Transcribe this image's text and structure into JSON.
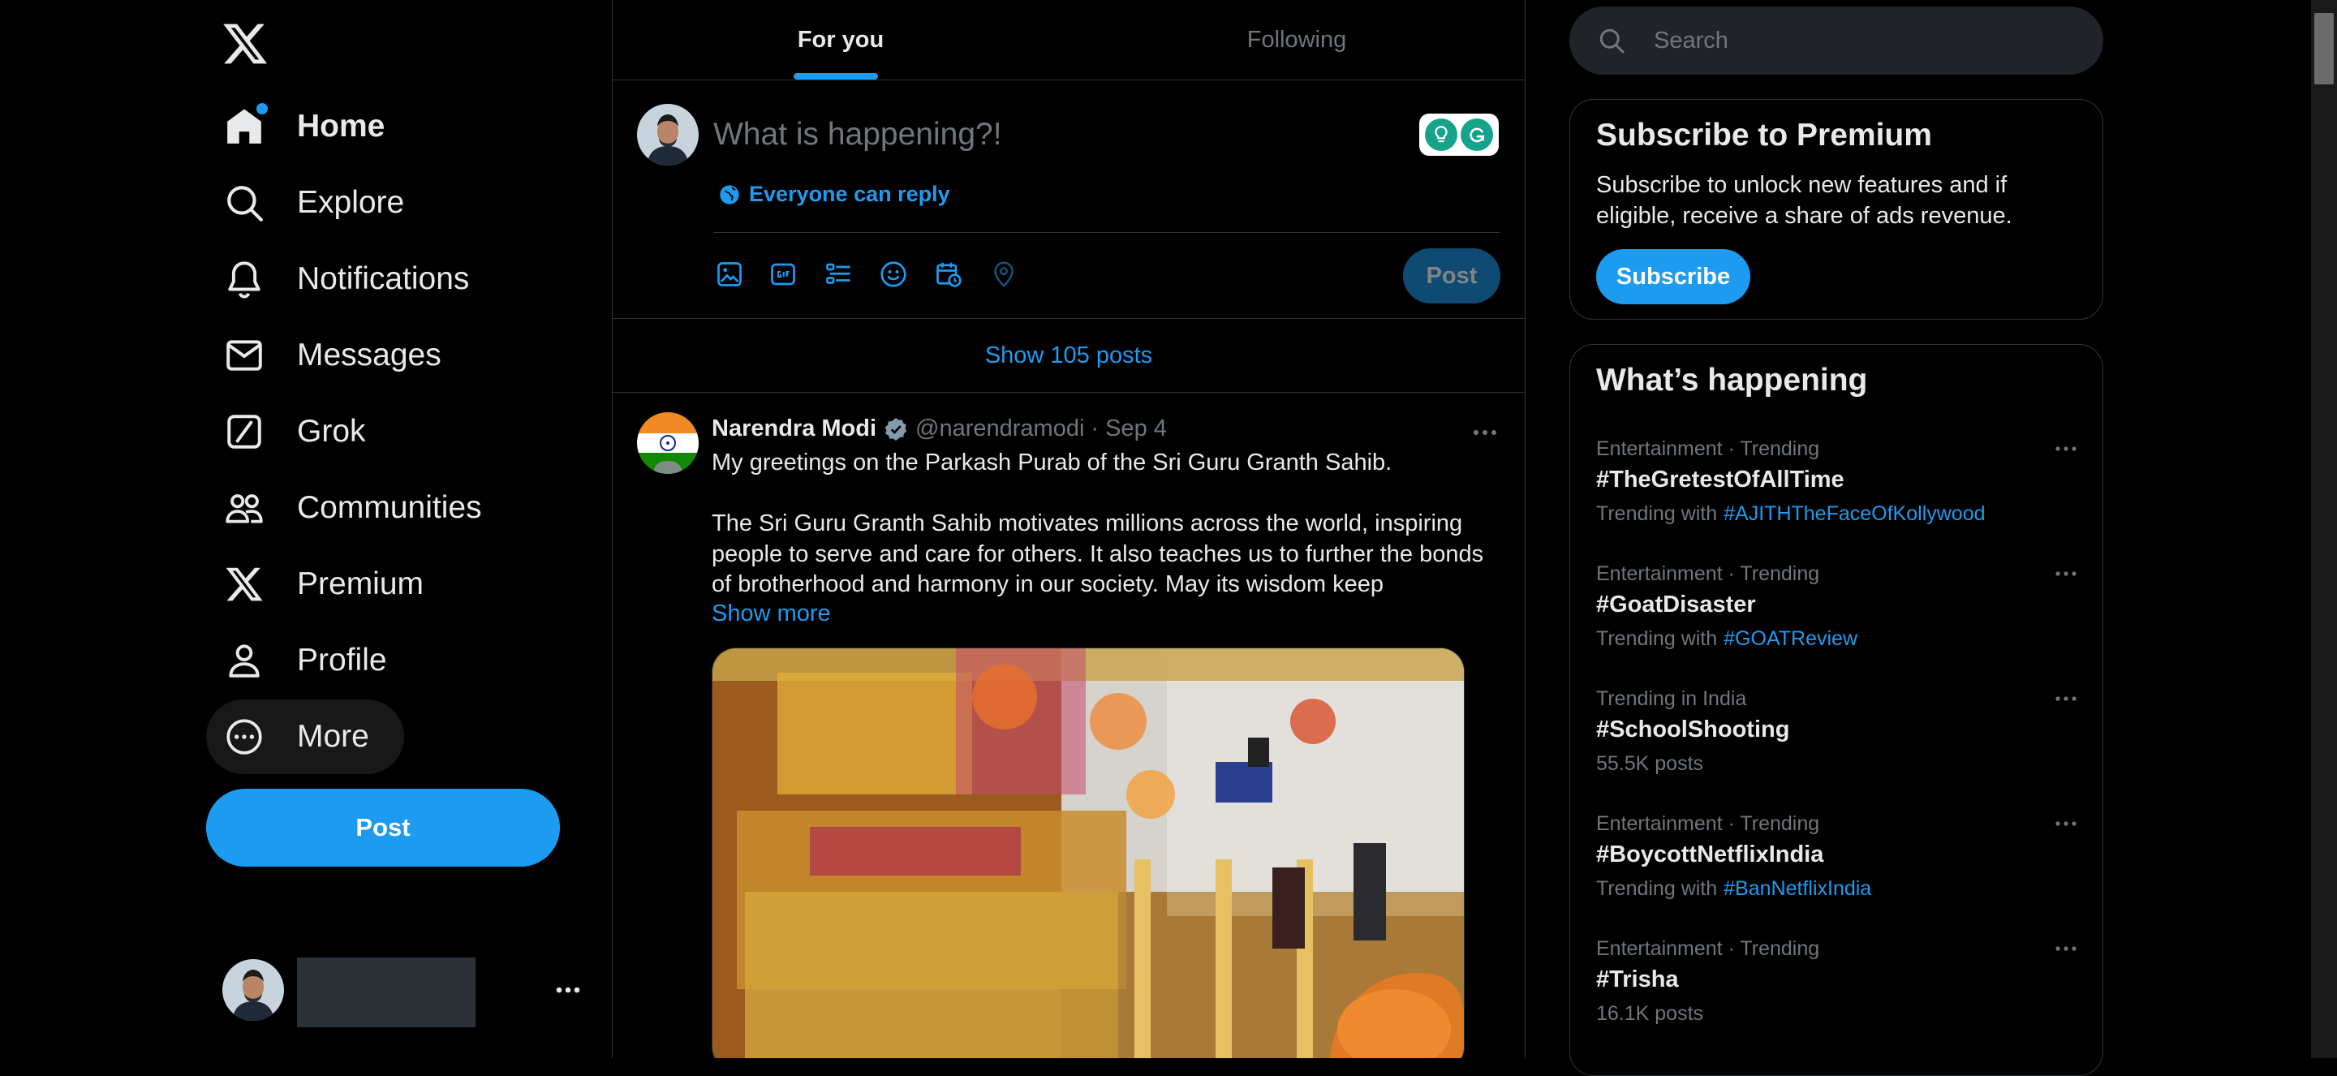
{
  "nav": {
    "items": [
      {
        "label": "Home",
        "icon": "home-icon",
        "active": true
      },
      {
        "label": "Explore",
        "icon": "search-icon"
      },
      {
        "label": "Notifications",
        "icon": "bell-icon"
      },
      {
        "label": "Messages",
        "icon": "envelope-icon"
      },
      {
        "label": "Grok",
        "icon": "grok-icon"
      },
      {
        "label": "Communities",
        "icon": "communities-icon"
      },
      {
        "label": "Premium",
        "icon": "x-logo-icon"
      },
      {
        "label": "Profile",
        "icon": "person-icon"
      },
      {
        "label": "More",
        "icon": "more-circle-icon"
      }
    ],
    "post_label": "Post"
  },
  "feed": {
    "tabs": [
      {
        "label": "For you",
        "active": true
      },
      {
        "label": "Following"
      }
    ],
    "compose": {
      "placeholder": "What is happening?!",
      "reply_setting": "Everyone can reply",
      "post_label": "Post"
    },
    "show_posts": "Show 105 posts",
    "tweet": {
      "author": "Narendra Modi",
      "handle": "@narendramodi",
      "separator": "·",
      "date": "Sep 4",
      "lines": [
        "My greetings on the Parkash Purab of the Sri Guru Granth Sahib.",
        "",
        "The Sri Guru Granth Sahib motivates millions across the world, inspiring people to serve and care for others. It also teaches us to further the bonds of brotherhood and harmony in our society. May its wisdom keep"
      ],
      "show_more": "Show more"
    }
  },
  "sidebar": {
    "search_placeholder": "Search",
    "premium": {
      "title": "Subscribe to Premium",
      "description": "Subscribe to unlock new features and if eligible, receive a share of ads revenue.",
      "button": "Subscribe"
    },
    "trends": {
      "title": "What’s happening",
      "items": [
        {
          "meta": "Entertainment · Trending",
          "title": "#TheGretestOfAllTime",
          "sub_prefix": "Trending with",
          "sub_link": "#AJITHTheFaceOfKollywood"
        },
        {
          "meta": "Entertainment · Trending",
          "title": "#GoatDisaster",
          "sub_prefix": "Trending with",
          "sub_link": "#GOATReview"
        },
        {
          "meta": "Trending in India",
          "title": "#SchoolShooting",
          "sub_prefix": "55.5K posts",
          "sub_link": ""
        },
        {
          "meta": "Entertainment · Trending",
          "title": "#BoycottNetflixIndia",
          "sub_prefix": "Trending with",
          "sub_link": "#BanNetflixIndia"
        },
        {
          "meta": "Entertainment · Trending",
          "title": "#Trisha",
          "sub_prefix": "16.1K posts",
          "sub_link": ""
        }
      ]
    }
  },
  "colors": {
    "accent": "#1d9bf0",
    "background": "#000000",
    "text": "#e7e9ea",
    "muted": "#71767b",
    "border": "#2f3336"
  }
}
